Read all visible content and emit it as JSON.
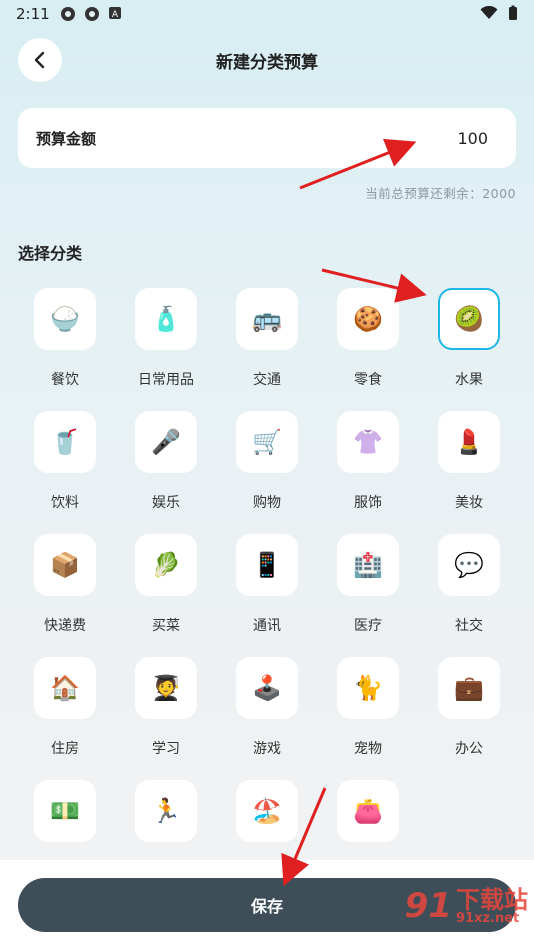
{
  "status_bar": {
    "time": "2:11"
  },
  "header": {
    "title": "新建分类预算"
  },
  "budget": {
    "label": "预算金额",
    "value": "100"
  },
  "remaining_text": "当前总预算还剩余：2000",
  "section_title": "选择分类",
  "categories": [
    {
      "label": "餐饮",
      "emoji": "🍚",
      "selected": false
    },
    {
      "label": "日常用品",
      "emoji": "🧴",
      "selected": false
    },
    {
      "label": "交通",
      "emoji": "🚌",
      "selected": false
    },
    {
      "label": "零食",
      "emoji": "🍪",
      "selected": false
    },
    {
      "label": "水果",
      "emoji": "🥝",
      "selected": true
    },
    {
      "label": "饮料",
      "emoji": "🥤",
      "selected": false
    },
    {
      "label": "娱乐",
      "emoji": "🎤",
      "selected": false
    },
    {
      "label": "购物",
      "emoji": "🛒",
      "selected": false
    },
    {
      "label": "服饰",
      "emoji": "👚",
      "selected": false
    },
    {
      "label": "美妆",
      "emoji": "💄",
      "selected": false
    },
    {
      "label": "快递费",
      "emoji": "📦",
      "selected": false
    },
    {
      "label": "买菜",
      "emoji": "🥬",
      "selected": false
    },
    {
      "label": "通讯",
      "emoji": "📱",
      "selected": false
    },
    {
      "label": "医疗",
      "emoji": "🏥",
      "selected": false
    },
    {
      "label": "社交",
      "emoji": "💬",
      "selected": false
    },
    {
      "label": "住房",
      "emoji": "🏠",
      "selected": false
    },
    {
      "label": "学习",
      "emoji": "🧑‍🎓",
      "selected": false
    },
    {
      "label": "游戏",
      "emoji": "🕹️",
      "selected": false
    },
    {
      "label": "宠物",
      "emoji": "🐈",
      "selected": false
    },
    {
      "label": "办公",
      "emoji": "💼",
      "selected": false
    },
    {
      "label": "",
      "emoji": "💵",
      "selected": false
    },
    {
      "label": "",
      "emoji": "🏃",
      "selected": false
    },
    {
      "label": "",
      "emoji": "🏖️",
      "selected": false
    },
    {
      "label": "",
      "emoji": "👛",
      "selected": false
    }
  ],
  "save_label": "保存",
  "watermark": {
    "logo": "91",
    "line1": "下载站",
    "line2": "91xz.net"
  },
  "colors": {
    "accent": "#1fb6e8",
    "save_button": "#3d4e58",
    "annotation_arrow": "#e02020"
  }
}
